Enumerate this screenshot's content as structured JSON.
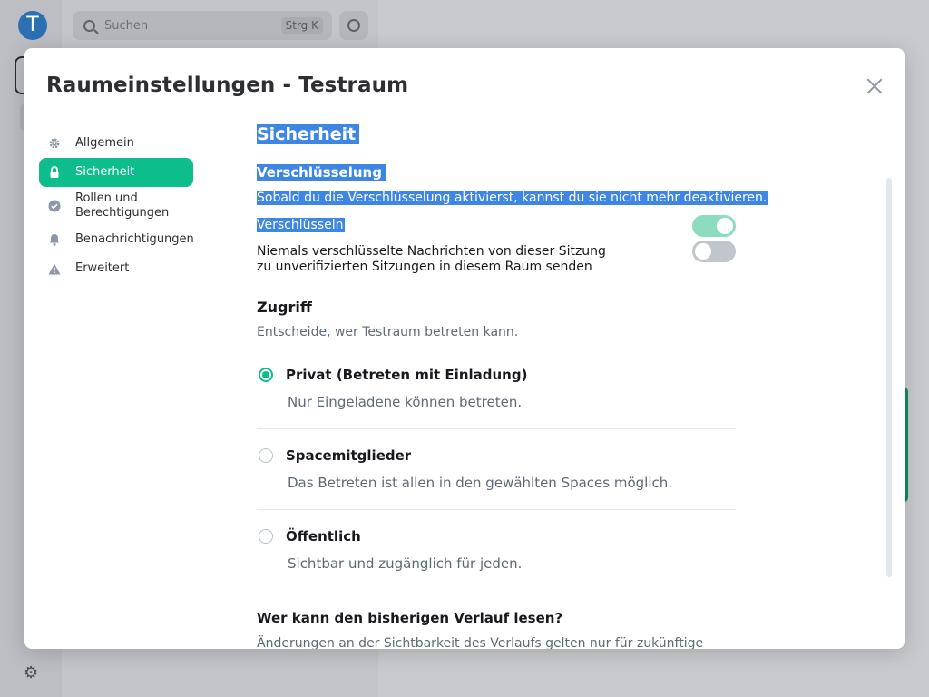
{
  "background": {
    "avatar_letter": "T",
    "search_placeholder": "Suchen",
    "search_shortcut": "Strg K"
  },
  "dialog": {
    "title": "Raumeinstellungen - Testraum",
    "nav": [
      {
        "label": "Allgemein",
        "icon": "gear-icon"
      },
      {
        "label": "Sicherheit",
        "icon": "lock-icon",
        "active": true
      },
      {
        "label": "Rollen und Berechtigungen",
        "icon": "shield-check-icon"
      },
      {
        "label": "Benachrichtigungen",
        "icon": "bell-icon"
      },
      {
        "label": "Erweitert",
        "icon": "warning-icon"
      }
    ],
    "security": {
      "heading": "Sicherheit",
      "encryption_heading": "Verschlüsselung",
      "encryption_desc": "Sobald du die Verschlüsselung aktivierst, kannst du sie nicht mehr deaktivieren.",
      "encrypt_label": "Verschlüsseln",
      "encrypt_on": true,
      "never_send_label": "Niemals verschlüsselte Nachrichten von dieser Sitzung zu unverifizierten Sitzungen in diesem Raum senden",
      "never_send_on": false
    },
    "access": {
      "heading": "Zugriff",
      "desc": "Entscheide, wer Testraum betreten kann.",
      "options": [
        {
          "label": "Privat (Betreten mit Einladung)",
          "desc": "Nur Eingeladene können betreten.",
          "checked": true
        },
        {
          "label": "Spacemitglieder",
          "desc": "Das Betreten ist allen in den gewählten Spaces möglich.",
          "checked": false
        },
        {
          "label": "Öffentlich",
          "desc": "Sichtbar und zugänglich für jeden.",
          "checked": false
        }
      ]
    },
    "history": {
      "heading": "Wer kann den bisherigen Verlauf lesen?",
      "desc": "Änderungen an der Sichtbarkeit des Verlaufs gelten nur für zukünftige"
    }
  },
  "colors": {
    "accent": "#0dbd8b",
    "selection": "#3d86e4",
    "muted_text": "#5e6a77"
  }
}
